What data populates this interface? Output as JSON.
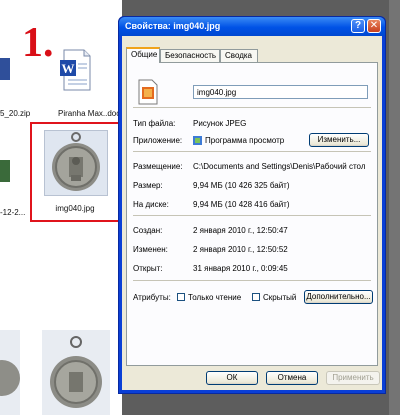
{
  "explorer": {
    "marker": "1.",
    "file_zip": "5_20.zip",
    "file_doc": "Piranha Max..doc",
    "file_partial": "-12-2...",
    "file_selected": "img040.jpg"
  },
  "dialog": {
    "title": "Свойства: img040.jpg",
    "help_glyph": "?",
    "close_glyph": "✕",
    "tabs": [
      "Общие",
      "Безопасность",
      "Сводка"
    ],
    "file_name": "img040.jpg",
    "rows": {
      "type_label": "Тип файла:",
      "type_value": "Рисунок JPEG",
      "app_label": "Приложение:",
      "app_value": "Программа просмотр",
      "change_button": "Изменить...",
      "location_label": "Размещение:",
      "location_value": "C:\\Documents and Settings\\Denis\\Рабочий стол",
      "size_label": "Размер:",
      "size_value": "9,94 МБ (10 426 325 байт)",
      "disk_label": "На диске:",
      "disk_value": "9,94 МБ (10 428 416 байт)",
      "created_label": "Создан:",
      "created_value": "2 января 2010 г., 12:50:47",
      "modified_label": "Изменен:",
      "modified_value": "2 января 2010 г., 12:50:52",
      "opened_label": "Открыт:",
      "opened_value": "31 января 2010 г., 0:09:45",
      "attributes_label": "Атрибуты:",
      "readonly_label": "Только чтение",
      "hidden_label": "Скрытый",
      "advanced_button": "Дополнительно..."
    },
    "buttons": {
      "ok": "ОК",
      "cancel": "Отмена",
      "apply": "Применить"
    }
  }
}
